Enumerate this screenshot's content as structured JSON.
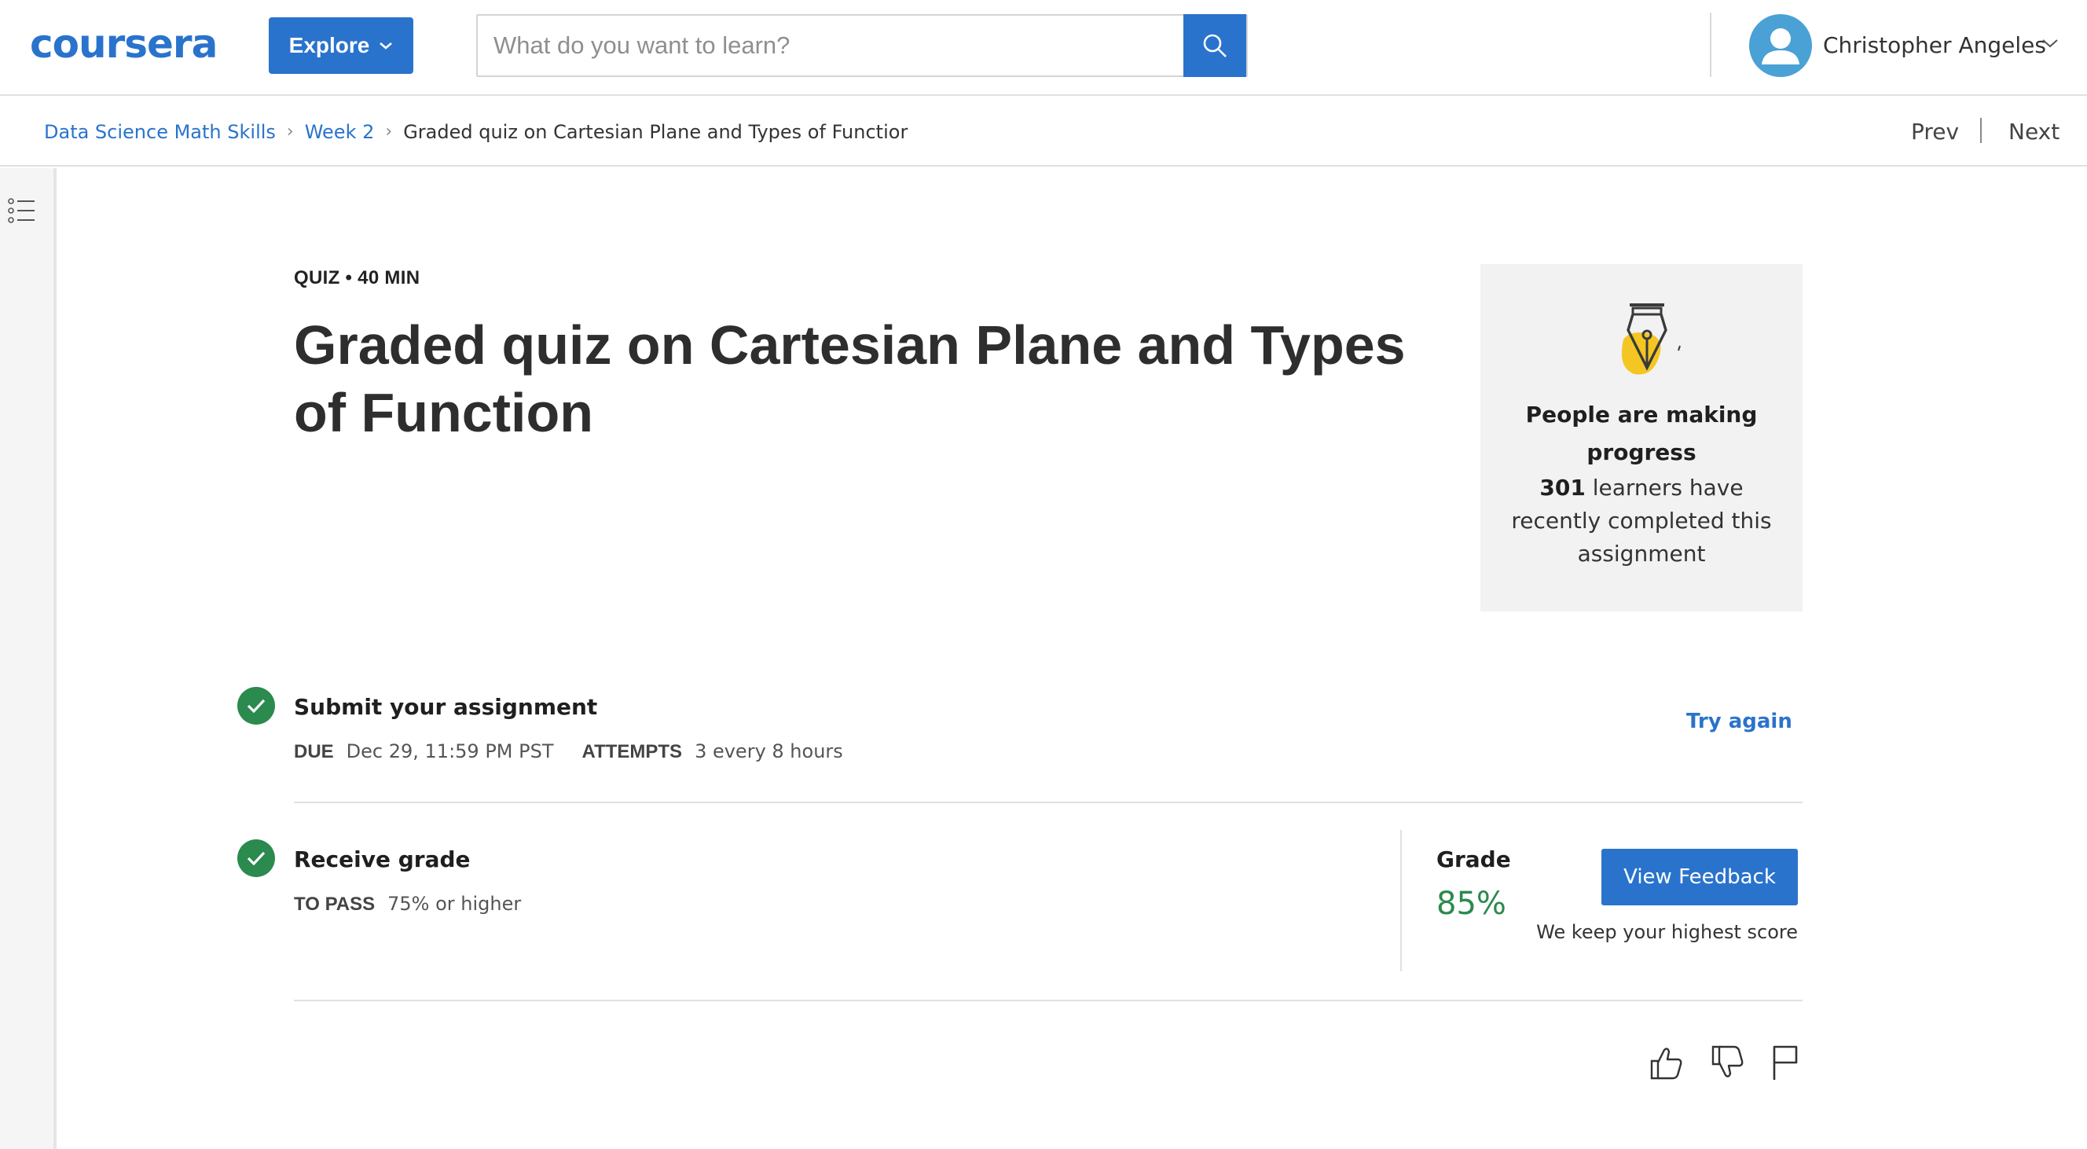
{
  "header": {
    "logo_text": "coursera",
    "explore_label": "Explore",
    "search_placeholder": "What do you want to learn?",
    "user_name": "Christopher Angeles"
  },
  "breadcrumb": {
    "items": [
      "Data Science Math Skills",
      "Week 2"
    ],
    "current": "Graded quiz on Cartesian Plane and Types of Functior",
    "prev_label": "Prev",
    "next_label": "Next"
  },
  "quiz": {
    "meta": "QUIZ • 40 MIN",
    "title": "Graded quiz on Cartesian Plane and Types of Function"
  },
  "progress_card": {
    "heading": "People are making progress",
    "count": "301",
    "body": " learners have recently completed this assignment"
  },
  "submit_step": {
    "title": "Submit your assignment",
    "due_label": "DUE",
    "due_value": "Dec 29, 11:59 PM PST",
    "attempts_label": "ATTEMPTS",
    "attempts_value": "3 every 8 hours",
    "try_again_label": "Try again"
  },
  "grade_step": {
    "title": "Receive grade",
    "to_pass_label": "TO PASS",
    "to_pass_value": "75% or higher",
    "grade_label": "Grade",
    "grade_value": "85%",
    "feedback_button": "View Feedback",
    "note": "We keep your highest score"
  },
  "colors": {
    "brand_blue": "#2a73cc",
    "success_green": "#2b8a4d",
    "card_bg": "#f2f2f2",
    "accent_yellow": "#f3c623"
  },
  "icons": {
    "search": "search-icon",
    "chevron": "chevron-down-icon",
    "user": "user-avatar-icon",
    "outline": "list-outline-icon",
    "pen": "pen-nib-icon",
    "check": "check-icon",
    "like": "thumbs-up-icon",
    "dislike": "thumbs-down-icon",
    "flag": "flag-icon"
  }
}
